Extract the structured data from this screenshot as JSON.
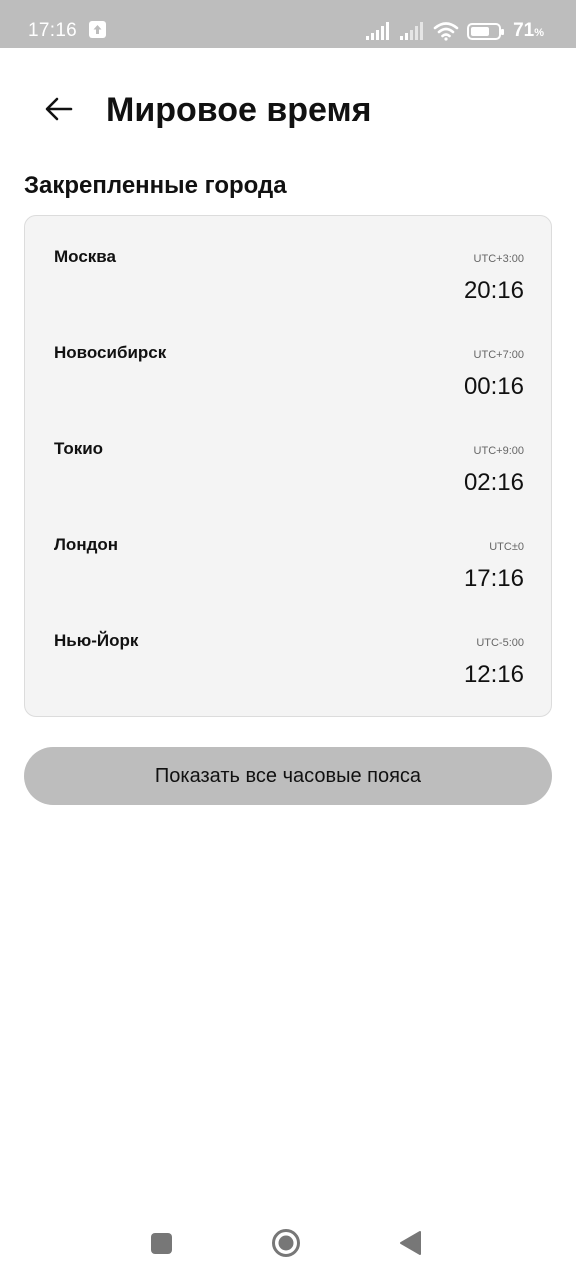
{
  "status_bar": {
    "time": "17:16",
    "battery_percent": "71",
    "battery_sign": "%",
    "battery_level": 0.71,
    "icons": [
      "upload-notification-icon",
      "signal-icon",
      "signal-icon",
      "wifi-icon",
      "battery-icon"
    ]
  },
  "header": {
    "back_icon": "arrow-left-icon",
    "title": "Мировое время"
  },
  "section": {
    "title": "Закрепленные города"
  },
  "cities": [
    {
      "name": "Москва",
      "offset": "UTC+3:00",
      "time": "20:16"
    },
    {
      "name": "Новосибирск",
      "offset": "UTC+7:00",
      "time": "00:16"
    },
    {
      "name": "Токио",
      "offset": "UTC+9:00",
      "time": "02:16"
    },
    {
      "name": "Лондон",
      "offset": "UTC±0",
      "time": "17:16"
    },
    {
      "name": "Нью-Йорк",
      "offset": "UTC-5:00",
      "time": "12:16"
    }
  ],
  "show_all_button": {
    "label": "Показать все часовые пояса"
  },
  "nav_bar": {
    "icons": [
      "recents-square-icon",
      "home-circle-icon",
      "back-triangle-icon"
    ]
  },
  "colors": {
    "status_bar_bg": "#bdbdbd",
    "card_bg": "#f4f4f4",
    "button_bg": "#bdbdbd",
    "text": "#111111"
  }
}
